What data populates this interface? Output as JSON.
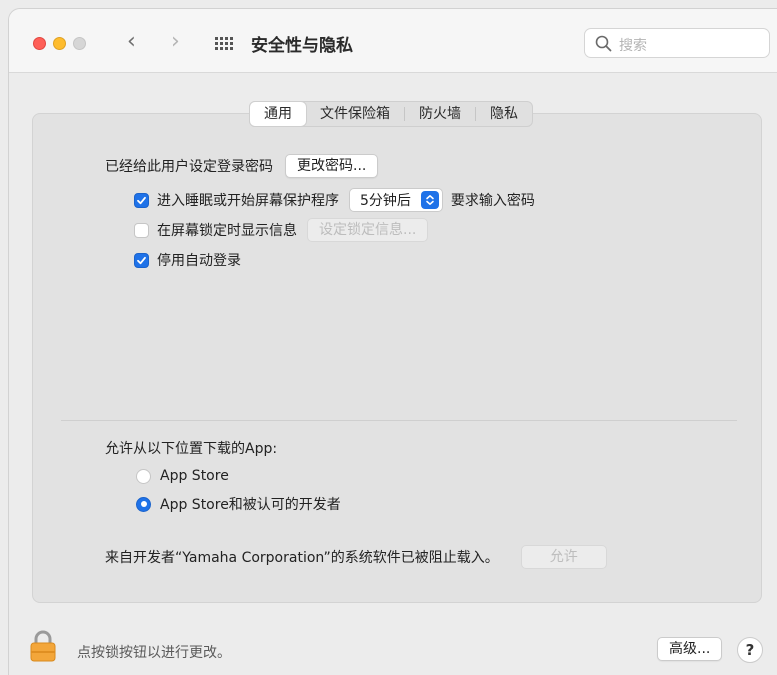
{
  "window": {
    "title": "安全性与隐私",
    "back_glyph": "‹",
    "forward_glyph": "›"
  },
  "search": {
    "placeholder": "搜索"
  },
  "tabs": [
    {
      "label": "通用",
      "active": true
    },
    {
      "label": "文件保险箱",
      "active": false
    },
    {
      "label": "防火墙",
      "active": false
    },
    {
      "label": "隐私",
      "active": false
    }
  ],
  "general": {
    "password_set_label": "已经给此用户设定登录密码",
    "change_password_button": "更改密码...",
    "sleep_checkbox": {
      "label": "进入睡眠或开始屏幕保护程序",
      "checked": true
    },
    "sleep_delay_select": {
      "value": "5分钟后"
    },
    "require_password_label": "要求输入密码",
    "lock_message_checkbox": {
      "label": "在屏幕锁定时显示信息",
      "checked": false
    },
    "set_lock_message_button": "设定锁定信息...",
    "disable_autologin_checkbox": {
      "label": "停用自动登录",
      "checked": true
    }
  },
  "downloads": {
    "heading": "允许从以下位置下载的App:",
    "options": [
      {
        "label": "App Store",
        "selected": false
      },
      {
        "label": "App Store和被认可的开发者",
        "selected": true
      }
    ],
    "blocked_message": "来自开发者“Yamaha Corporation”的系统软件已被阻止载入。",
    "allow_button": "允许"
  },
  "footer": {
    "lock_text": "点按锁按钮以进行更改。",
    "advanced_button": "高级...",
    "help_button": "?"
  },
  "colors": {
    "accent": "#1f72e8",
    "close": "#fe5f57",
    "minimize": "#febc2e"
  }
}
